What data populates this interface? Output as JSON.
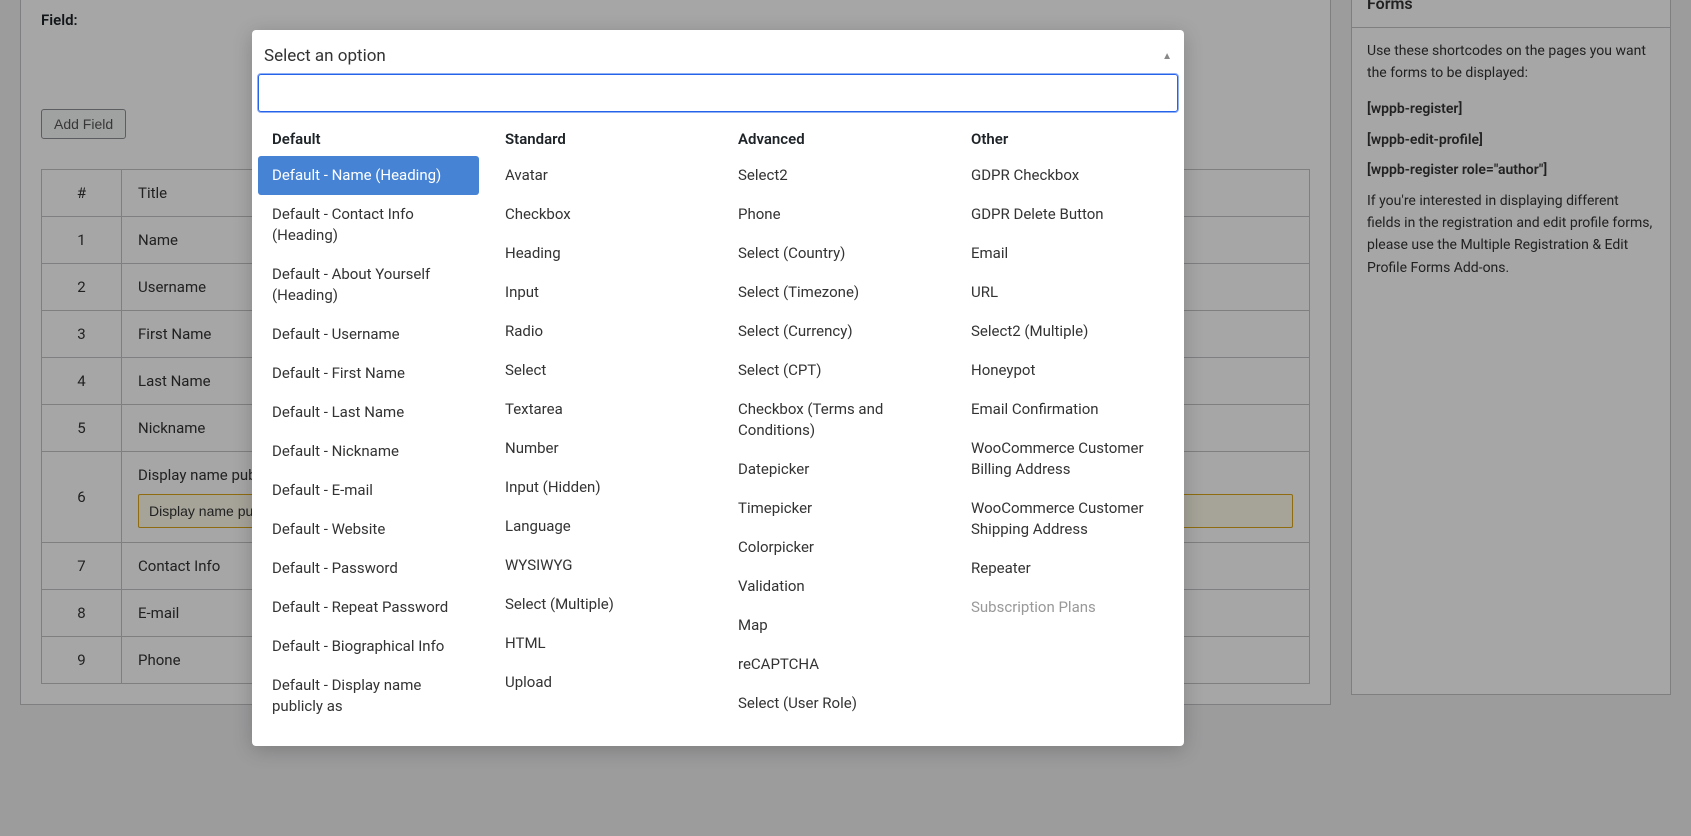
{
  "field_label": "Field:",
  "add_field_btn": "Add Field",
  "table": {
    "headers": {
      "num": "#",
      "title": "Title"
    },
    "rows": [
      {
        "num": "1",
        "title": "Name"
      },
      {
        "num": "2",
        "title": "Username"
      },
      {
        "num": "3",
        "title": "First Name"
      },
      {
        "num": "4",
        "title": "Last Name"
      },
      {
        "num": "5",
        "title": "Nickname"
      },
      {
        "num": "6",
        "title": "Display name publicly as",
        "input_value": "Display name publicly as"
      },
      {
        "num": "7",
        "title": "Contact Info"
      },
      {
        "num": "8",
        "title": "E-mail"
      },
      {
        "num": "9",
        "title": "Phone"
      }
    ]
  },
  "sidebar": {
    "heading": "Forms",
    "intro": "Use these shortcodes on the pages you want the forms to be displayed:",
    "shortcodes": [
      "[wppb-register]",
      "[wppb-edit-profile]",
      "[wppb-register role=\"author\"]"
    ],
    "note": "If you're interested in displaying different fields in the registration and edit profile forms, please use the Multiple Registration & Edit Profile Forms Add-ons."
  },
  "dropdown": {
    "placeholder": "Select an option",
    "search_value": "",
    "groups": {
      "default": {
        "label": "Default",
        "options": [
          "Default - Name (Heading)",
          "Default - Contact Info (Heading)",
          "Default - About Yourself (Heading)",
          "Default - Username",
          "Default - First Name",
          "Default - Last Name",
          "Default - Nickname",
          "Default - E-mail",
          "Default - Website",
          "Default - Password",
          "Default - Repeat Password",
          "Default - Biographical Info",
          "Default - Display name publicly as"
        ]
      },
      "standard": {
        "label": "Standard",
        "options": [
          "Avatar",
          "Checkbox",
          "Heading",
          "Input",
          "Radio",
          "Select",
          "Textarea",
          "Number",
          "Input (Hidden)",
          "Language",
          "WYSIWYG",
          "Select (Multiple)",
          "HTML",
          "Upload"
        ]
      },
      "advanced": {
        "label": "Advanced",
        "options": [
          "Select2",
          "Phone",
          "Select (Country)",
          "Select (Timezone)",
          "Select (Currency)",
          "Select (CPT)",
          "Checkbox (Terms and Conditions)",
          "Datepicker",
          "Timepicker",
          "Colorpicker",
          "Validation",
          "Map",
          "reCAPTCHA",
          "Select (User Role)"
        ]
      },
      "other": {
        "label": "Other",
        "options": [
          "GDPR Checkbox",
          "GDPR Delete Button",
          "Email",
          "URL",
          "Select2 (Multiple)",
          "Honeypot",
          "Email Confirmation",
          "WooCommerce Customer Billing Address",
          "WooCommerce Customer Shipping Address",
          "Repeater",
          "Subscription Plans"
        ],
        "disabled_indices": [
          10
        ]
      }
    }
  }
}
